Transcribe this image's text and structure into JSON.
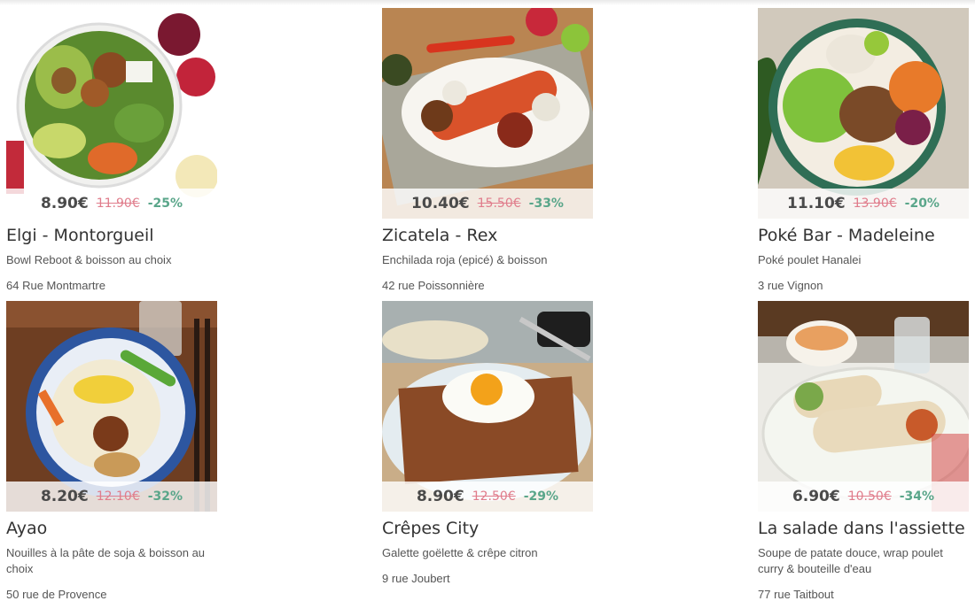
{
  "restaurants": [
    {
      "name": "Elgi - Montorgueil",
      "offer": "Bowl Reboot & boisson au choix",
      "address": "64 Rue Montmartre",
      "price": "8.90€",
      "old_price": "11.90€",
      "discount": "-25%"
    },
    {
      "name": "Zicatela - Rex",
      "offer": "Enchilada roja (epicé) & boisson",
      "address": "42 rue Poissonnière",
      "price": "10.40€",
      "old_price": "15.50€",
      "discount": "-33%"
    },
    {
      "name": "Poké Bar - Madeleine",
      "offer": "Poké poulet Hanalei",
      "address": "3 rue Vignon",
      "price": "11.10€",
      "old_price": "13.90€",
      "discount": "-20%"
    },
    {
      "name": "Ayao",
      "offer": "Nouilles à la pâte de soja & boisson au choix",
      "address": "50 rue de Provence",
      "price": "8.20€",
      "old_price": "12.10€",
      "discount": "-32%"
    },
    {
      "name": "Crêpes City",
      "offer": "Galette goëlette & crêpe citron",
      "address": "9 rue Joubert",
      "price": "8.90€",
      "old_price": "12.50€",
      "discount": "-29%"
    },
    {
      "name": "La salade dans l'assiette",
      "offer": "Soupe de patate douce, wrap poulet curry & bouteille d'eau",
      "address": "77 rue Taitbout",
      "price": "6.90€",
      "old_price": "10.50€",
      "discount": "-34%"
    }
  ],
  "colors": {
    "price": "#4a4a4a",
    "old_price": "#e07d8c",
    "discount": "#5aa68a"
  }
}
